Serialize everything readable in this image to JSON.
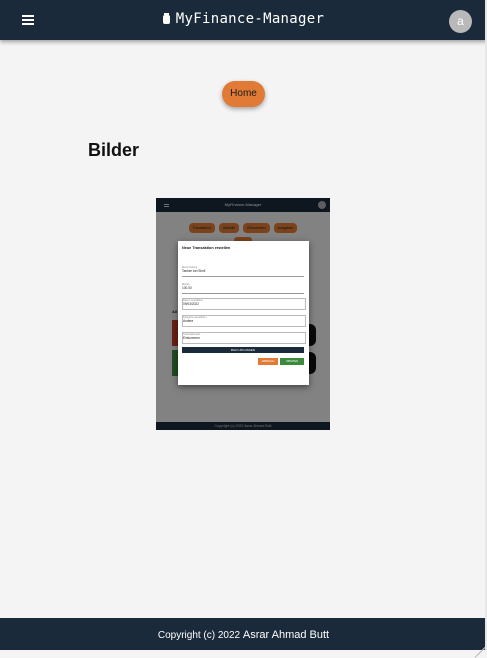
{
  "header": {
    "title": "MyFinance-Manager",
    "avatar_initial": "a"
  },
  "main": {
    "home_button": "Home",
    "section_title": "Bilder"
  },
  "image_preview": {
    "title": "MyFinance-Manager",
    "tabs": [
      "Transaktion",
      "Statistik",
      "Einkommen",
      "Ausgaben"
    ],
    "dialog": {
      "title": "Neue Transaktion erstellen",
      "fields": [
        {
          "label": "Beschreibung",
          "value": "Tanken bei Shell"
        },
        {
          "label": "Betrag",
          "value": "100.00"
        },
        {
          "label": "Datum auswählen",
          "value": "09/03/2022"
        },
        {
          "label": "Kategorie auswählen",
          "value": "Andere"
        },
        {
          "label": "Transaktionsart",
          "value": "Einkommen"
        }
      ],
      "upload_label": "BILD UPLOADEN",
      "abort_label": "ABBRUCH",
      "update_label": "UPDATEN"
    },
    "footer_text": "Copyright (c) 2022 Asrar Ahmad Butt"
  },
  "footer": {
    "text_prefix": "Copyright (c) 2022",
    "author": "Asrar Ahmad Butt"
  }
}
